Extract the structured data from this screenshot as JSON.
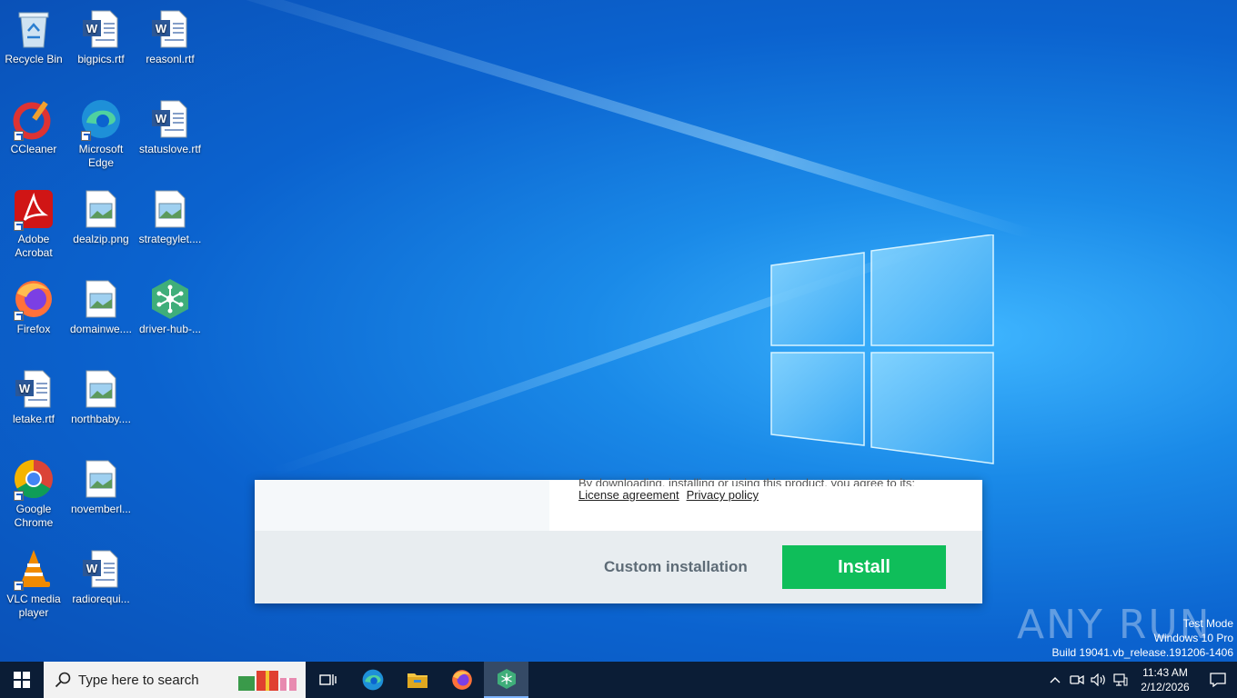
{
  "desktop": {
    "icons": [
      {
        "label": "Recycle Bin",
        "icon": "recycle-bin-icon"
      },
      {
        "label": "bigpics.rtf",
        "icon": "word-document-icon"
      },
      {
        "label": "reasonl.rtf",
        "icon": "word-document-icon"
      },
      {
        "label": "CCleaner",
        "icon": "ccleaner-icon"
      },
      {
        "label": "Microsoft Edge",
        "icon": "edge-icon"
      },
      {
        "label": "statuslove.rtf",
        "icon": "word-document-icon"
      },
      {
        "label": "Adobe Acrobat",
        "icon": "acrobat-icon"
      },
      {
        "label": "dealzip.png",
        "icon": "image-file-icon"
      },
      {
        "label": "strategylet....",
        "icon": "image-file-icon"
      },
      {
        "label": "Firefox",
        "icon": "firefox-icon"
      },
      {
        "label": "domainwe....",
        "icon": "image-file-icon"
      },
      {
        "label": "driver-hub-...",
        "icon": "driver-hub-icon"
      },
      {
        "label": "letake.rtf",
        "icon": "word-document-icon"
      },
      {
        "label": "northbaby....",
        "icon": "image-file-icon"
      },
      {
        "label": "Google Chrome",
        "icon": "chrome-icon"
      },
      {
        "label": "novemberl...",
        "icon": "image-file-icon"
      },
      {
        "label": "VLC media player",
        "icon": "vlc-icon"
      },
      {
        "label": "radiorequi...",
        "icon": "word-document-icon"
      }
    ]
  },
  "installer": {
    "legal_text": "By downloading, installing or using this product, you agree to its:",
    "license_link": "License agreement",
    "privacy_link": "Privacy policy",
    "custom_label": "Custom installation",
    "install_label": "Install",
    "accent": "#0fbe5a"
  },
  "watermark": {
    "text": "ANY RUN"
  },
  "system_info": {
    "line1": "Test Mode",
    "line2": "Windows 10 Pro",
    "line3": "Build 19041.vb_release.191206-1406"
  },
  "taskbar": {
    "search_placeholder": "Type here to search",
    "time": "11:43 AM",
    "date": "2/12/2026",
    "color": "#0b1d36"
  }
}
